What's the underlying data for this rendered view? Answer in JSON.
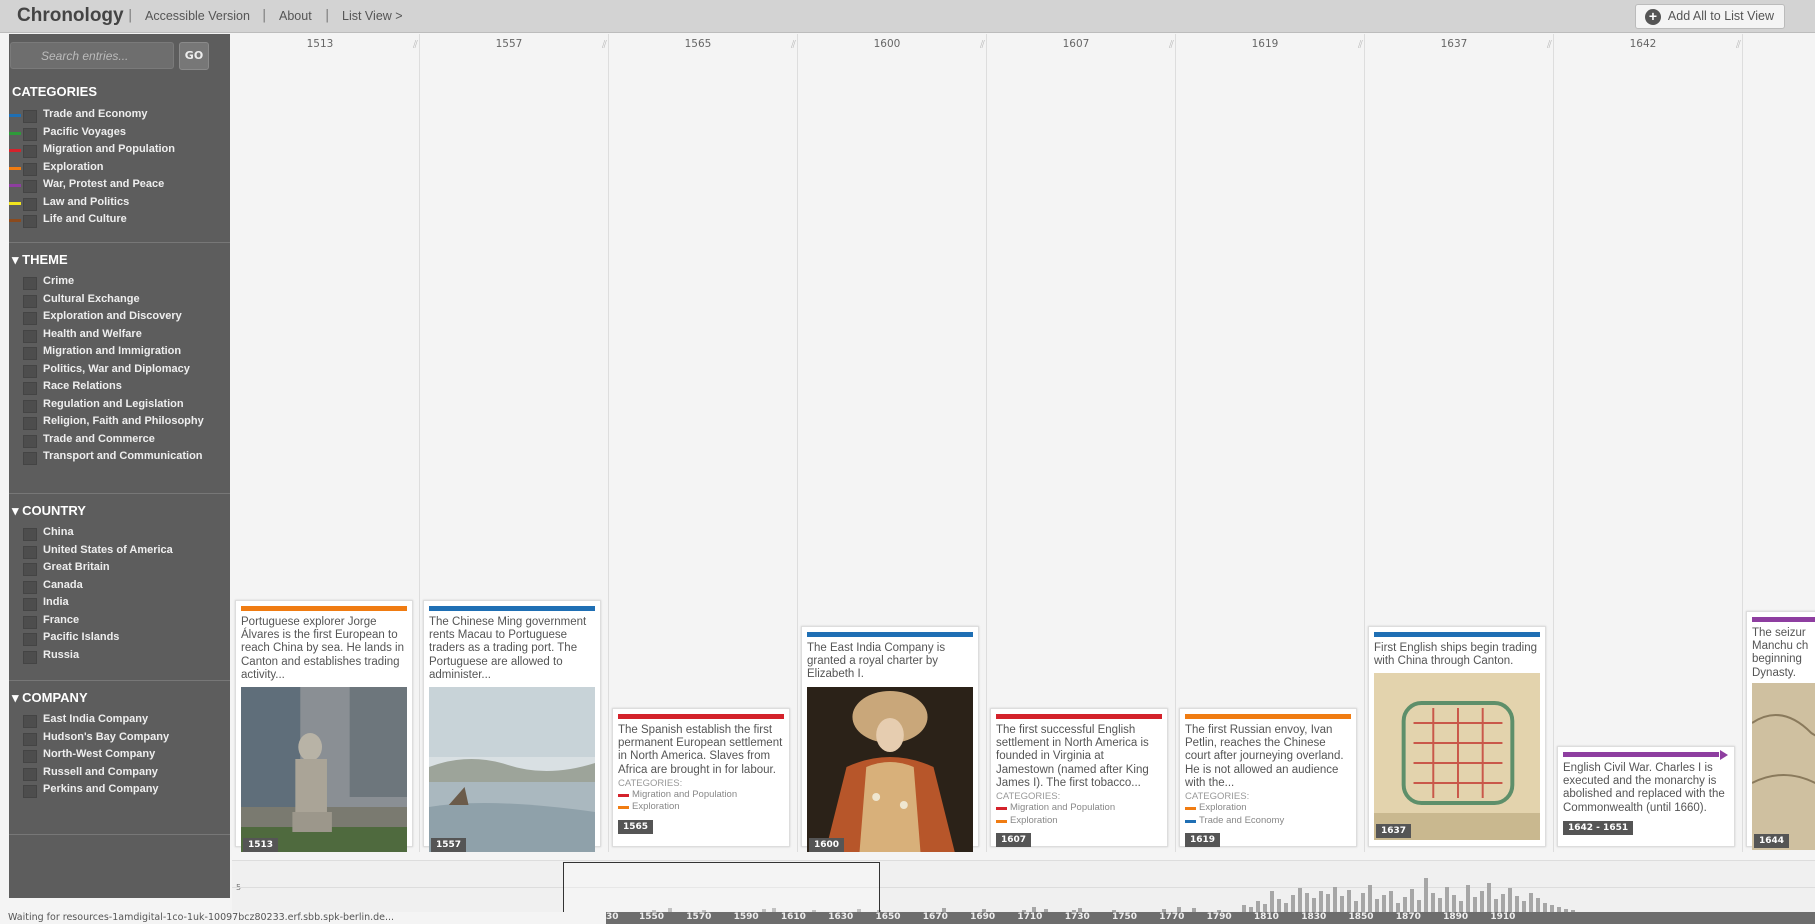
{
  "header": {
    "brand": "Chronology",
    "nav": [
      "Accessible Version",
      "About",
      "List View >"
    ],
    "add_all": "Add All to List View"
  },
  "search": {
    "placeholder": "Search entries...",
    "go": "GO"
  },
  "categories": {
    "title": "CATEGORIES",
    "items": [
      {
        "label": "Trade and Economy",
        "color": "#1f6fb4"
      },
      {
        "label": "Pacific Voyages",
        "color": "#2e9a3a"
      },
      {
        "label": "Migration and Population",
        "color": "#d4222b"
      },
      {
        "label": "Exploration",
        "color": "#f07c12"
      },
      {
        "label": "War, Protest and Peace",
        "color": "#8e3ea0"
      },
      {
        "label": "Law and Politics",
        "color": "#f2e51e"
      },
      {
        "label": "Life and Culture",
        "color": "#8b4a1d"
      }
    ]
  },
  "theme": {
    "title": "▾ THEME",
    "items": [
      "Crime",
      "Cultural Exchange",
      "Exploration and Discovery",
      "Health and Welfare",
      "Migration and Immigration",
      "Politics, War and Diplomacy",
      "Race Relations",
      "Regulation and Legislation",
      "Religion, Faith and Philosophy",
      "Trade and Commerce",
      "Transport and Communication"
    ]
  },
  "country": {
    "title": "▾ COUNTRY",
    "items": [
      "China",
      "United States of America",
      "Great Britain",
      "Canada",
      "India",
      "France",
      "Pacific Islands",
      "Russia"
    ]
  },
  "company": {
    "title": "▾ COMPANY",
    "items": [
      "East India Company",
      "Hudson's Bay Company",
      "North-West Company",
      "Russell and Company",
      "Perkins and Company"
    ]
  },
  "columns": [
    "1513",
    "1557",
    "1565",
    "1600",
    "1607",
    "1619",
    "1637",
    "1642"
  ],
  "cards": [
    {
      "text": "Portuguese explorer Jorge Álvares is the first European to reach China by sea. He lands in Canton and establishes trading activity...",
      "year": "1513",
      "color": "#f07c12"
    },
    {
      "text": "The Chinese Ming government rents Macau to Portuguese traders as a trading port. The Portuguese are allowed to administer...",
      "year": "1557",
      "color": "#1f6fb4"
    },
    {
      "text": "The Spanish establish the first permanent European settlement in North America. Slaves from Africa are brought in for labour.",
      "year": "1565",
      "color": "#d4222b",
      "cats_label": "CATEGORIES:",
      "cats": [
        {
          "label": "Migration and Population",
          "color": "#d4222b"
        },
        {
          "label": "Exploration",
          "color": "#f07c12"
        }
      ]
    },
    {
      "text": "The East India Company is granted a royal charter by Elizabeth I.",
      "year": "1600",
      "color": "#1f6fb4"
    },
    {
      "text": "The first successful English settlement in North America is founded in Virginia at Jamestown (named after King James I). The first tobacco...",
      "year": "1607",
      "color": "#d4222b",
      "cats_label": "CATEGORIES:",
      "cats": [
        {
          "label": "Migration and Population",
          "color": "#d4222b"
        },
        {
          "label": "Exploration",
          "color": "#f07c12"
        }
      ]
    },
    {
      "text": "The first Russian envoy, Ivan Petlin, reaches the Chinese court after journeying overland. He is not allowed an audience with the...",
      "year": "1619",
      "color": "#f07c12",
      "cats_label": "CATEGORIES:",
      "cats": [
        {
          "label": "Exploration",
          "color": "#f07c12"
        },
        {
          "label": "Trade and Economy",
          "color": "#1f6fb4"
        }
      ]
    },
    {
      "text": "First English ships begin trading with China through Canton.",
      "year": "1637",
      "color": "#1f6fb4"
    },
    {
      "text": "English Civil War. Charles I is executed and the monarchy is abolished and replaced with the Commonwealth (until 1660).",
      "year": "1642 - 1651",
      "color": "#8e3ea0"
    },
    {
      "text": "The seizur Manchu ch beginning Dynasty.",
      "year": "1644",
      "color": "#8e3ea0"
    }
  ],
  "histogram": {
    "y_label": "5",
    "axis_ticks": [
      "30",
      "1550",
      "1570",
      "1590",
      "1610",
      "1630",
      "1650",
      "1670",
      "1690",
      "1710",
      "1730",
      "1750",
      "1770",
      "1790",
      "1810",
      "1830",
      "1850",
      "1870",
      "1890",
      "1910"
    ]
  },
  "status": "Waiting for resources-1amdigital-1co-1uk-10097bcz80233.erf.sbb.spk-berlin.de..."
}
